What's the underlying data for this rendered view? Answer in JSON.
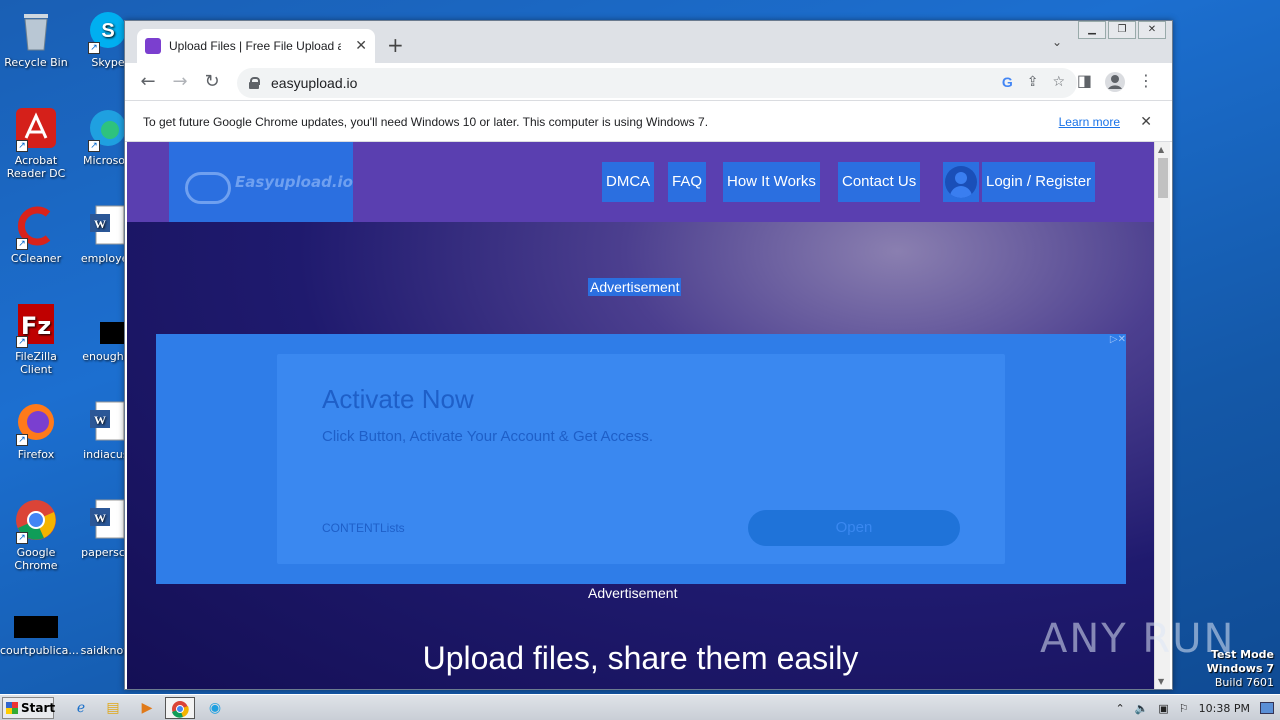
{
  "desktop": {
    "icons": [
      {
        "label": "Recycle Bin"
      },
      {
        "label": "Skype"
      },
      {
        "label": "Acrobat Reader DC"
      },
      {
        "label": "Microsoft"
      },
      {
        "label": "CCleaner"
      },
      {
        "label": "employee"
      },
      {
        "label": "FileZilla Client"
      },
      {
        "label": "enoughst"
      },
      {
        "label": "Firefox"
      },
      {
        "label": "indiacust"
      },
      {
        "label": "Google Chrome"
      },
      {
        "label": "papersclu"
      },
      {
        "label": "courtpublica..."
      },
      {
        "label": "saidknowl"
      }
    ]
  },
  "browser": {
    "tab_title": "Upload Files | Free File Upload and T",
    "tab_close": "✕",
    "new_tab": "+",
    "url": "easyupload.io",
    "infobar_message": "To get future Google Chrome updates, you'll need Windows 10 or later. This computer is using Windows 7.",
    "infobar_link": "Learn more"
  },
  "site": {
    "brand": "Easyupload.io",
    "nav": {
      "dmca": "DMCA",
      "faq": "FAQ",
      "how": "How It Works",
      "contact": "Contact Us",
      "login": "Login / Register"
    },
    "ad_label_top": "Advertisement",
    "ad_label_bottom": "Advertisement",
    "ad": {
      "headline": "Activate Now",
      "subtext": "Click Button, Activate Your Account & Get Access.",
      "footer": "CONTENTLists",
      "button": "Open"
    },
    "hero": "Upload files, share them easily"
  },
  "watermark": {
    "text": "ANY RUN",
    "test_mode_1": "Test Mode",
    "test_mode_2": "Windows 7",
    "test_mode_3": "Build 7601"
  },
  "taskbar": {
    "start": "Start",
    "clock": "10:38 PM"
  }
}
